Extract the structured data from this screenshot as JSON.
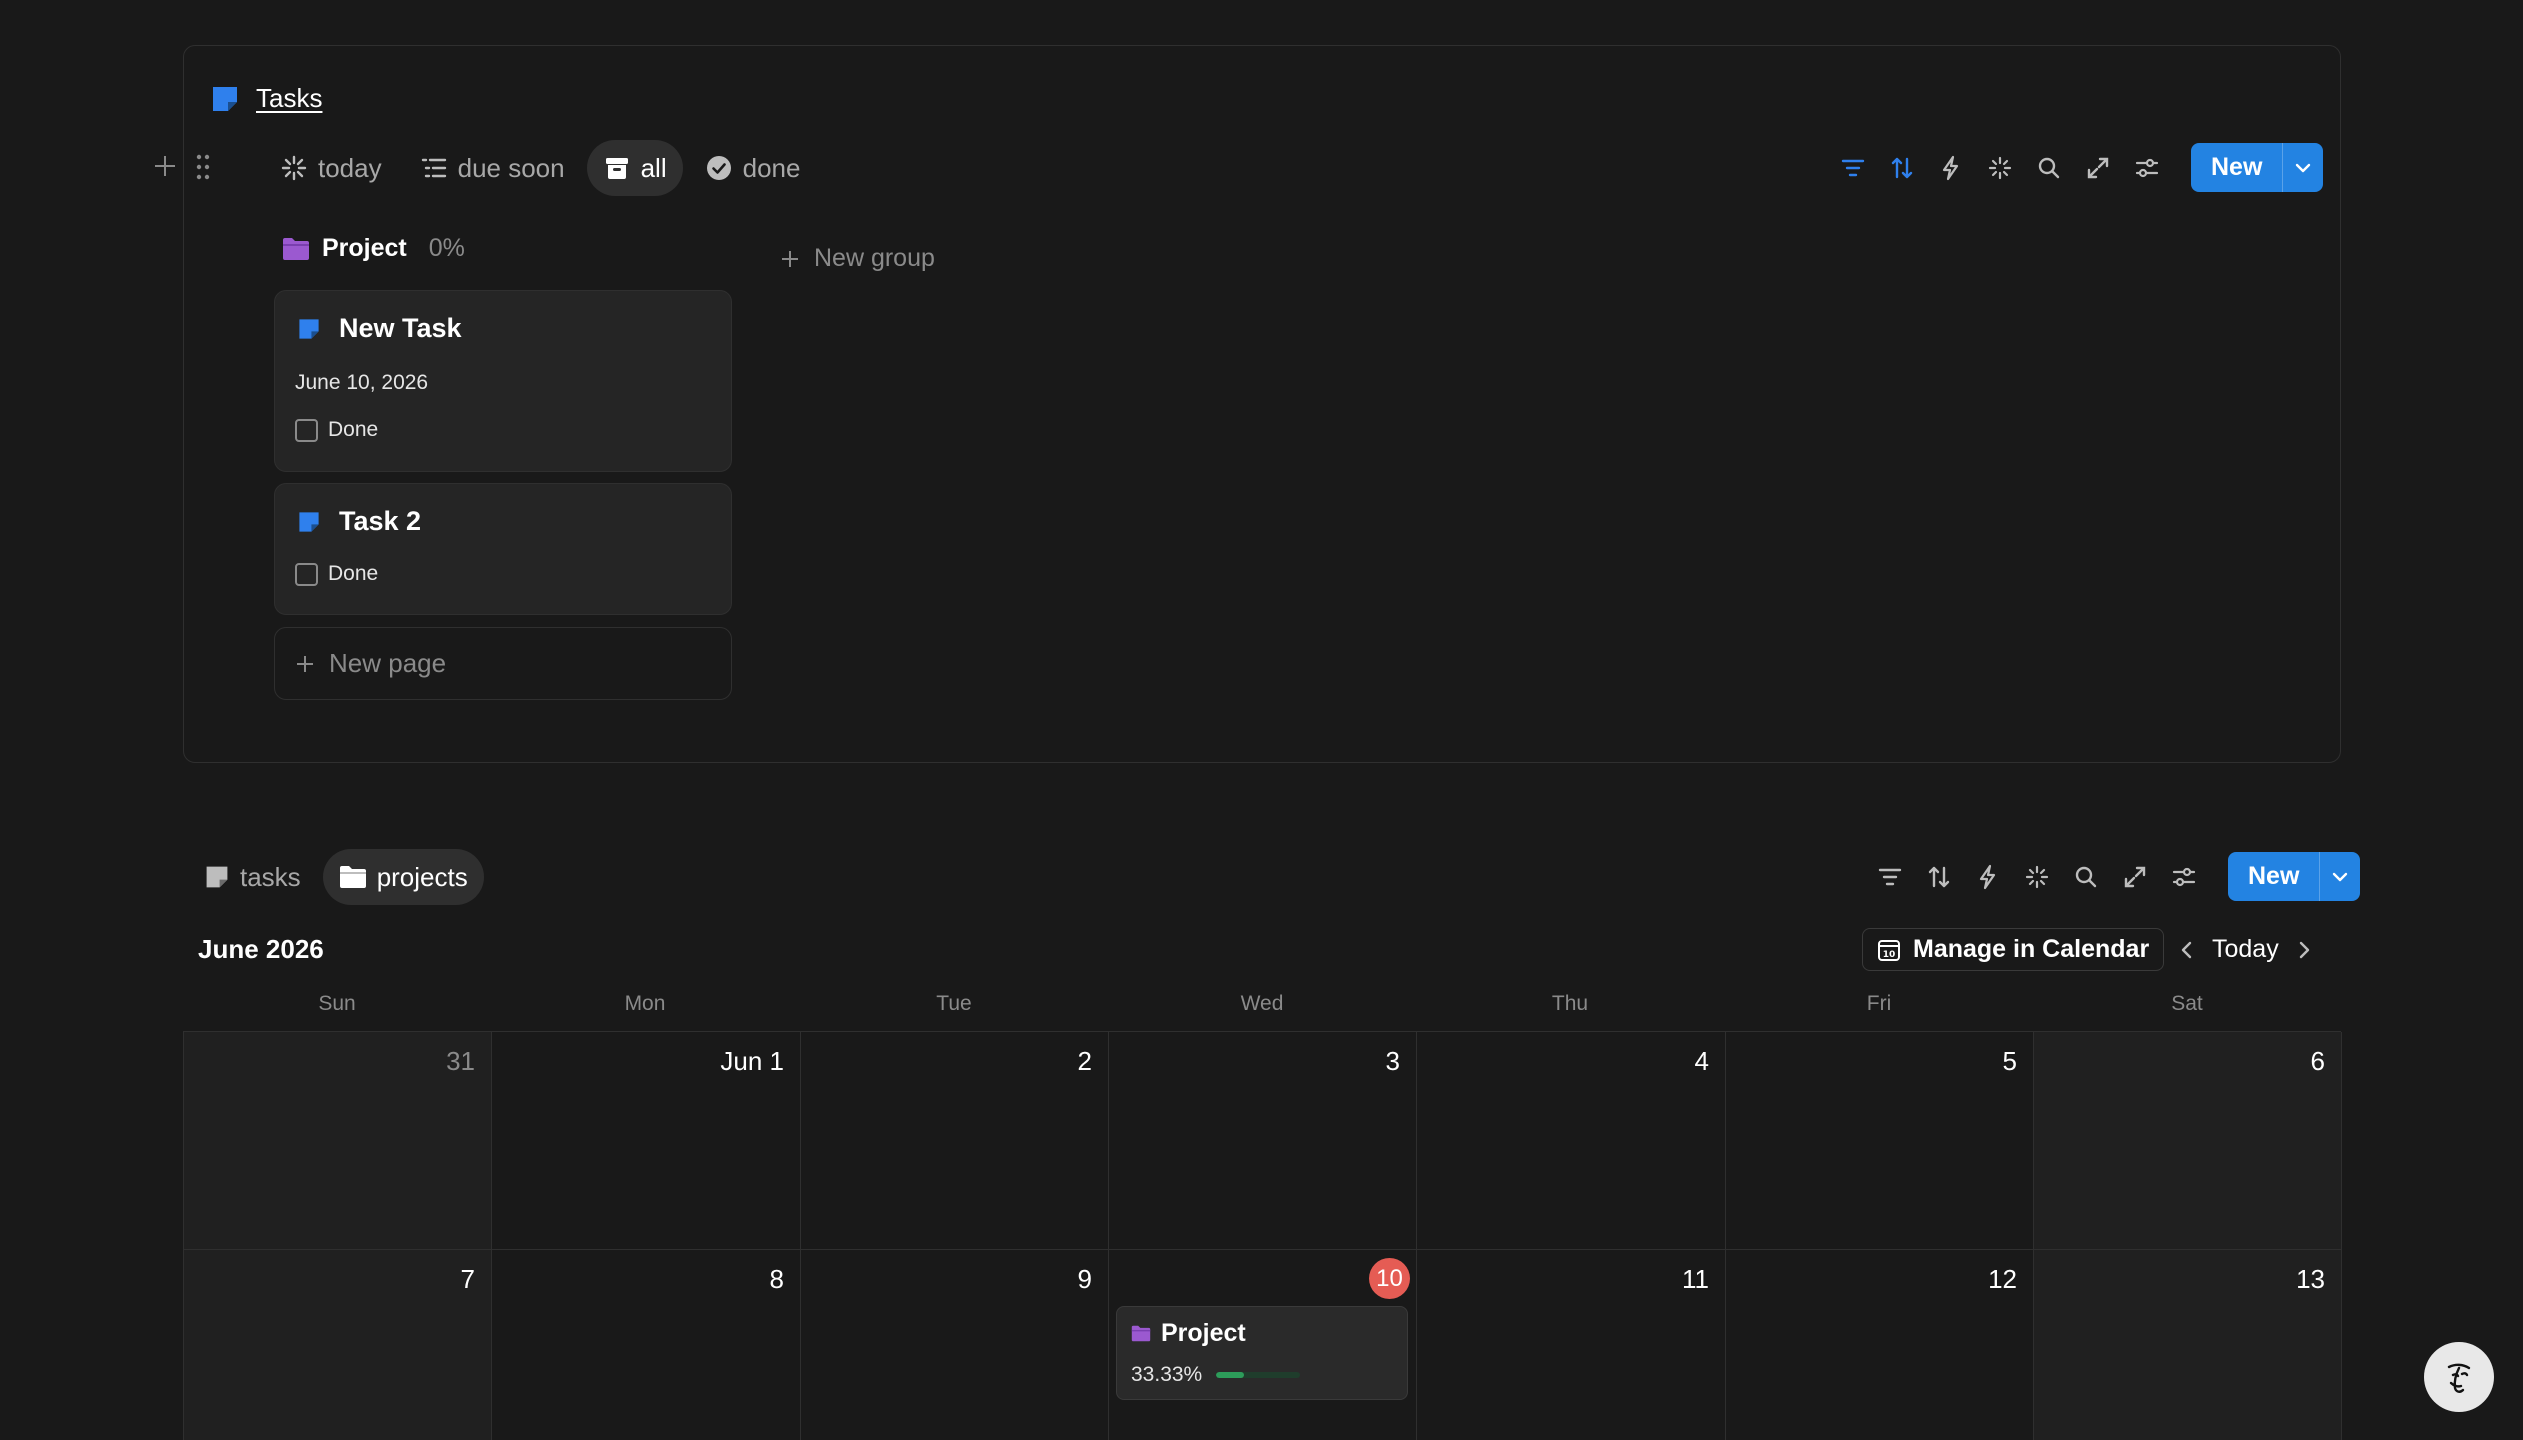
{
  "tasks_db": {
    "title": "Tasks",
    "tabs": [
      {
        "label": "today",
        "icon": "sparkle-loading-icon"
      },
      {
        "label": "due soon",
        "icon": "list-icon"
      },
      {
        "label": "all",
        "icon": "archive-icon",
        "active": true
      },
      {
        "label": "done",
        "icon": "check-circle-icon"
      }
    ],
    "toolbar": {
      "icons": [
        "filter-icon",
        "sort-icon",
        "lightning-icon",
        "sparkle-icon",
        "search-icon",
        "expand-icon",
        "settings-sliders-icon"
      ],
      "new_label": "New"
    },
    "group": {
      "name": "Project",
      "percent": "0%"
    },
    "cards": [
      {
        "title": "New Task",
        "date": "June 10, 2026",
        "done_label": "Done"
      },
      {
        "title": "Task 2",
        "done_label": "Done"
      }
    ],
    "new_page_label": "New page",
    "new_group_label": "New group"
  },
  "calendar_view": {
    "tabs": [
      {
        "label": "tasks",
        "icon": "page-icon"
      },
      {
        "label": "projects",
        "icon": "folder-icon",
        "active": true
      }
    ],
    "new_label": "New",
    "month_label": "June 2026",
    "manage_label": "Manage in Calendar",
    "today_label": "Today",
    "weekdays": [
      "Sun",
      "Mon",
      "Tue",
      "Wed",
      "Thu",
      "Fri",
      "Sat"
    ],
    "weeks": [
      [
        "31",
        "Jun 1",
        "2",
        "3",
        "4",
        "5",
        "6"
      ],
      [
        "7",
        "8",
        "9",
        "10",
        "11",
        "12",
        "13"
      ]
    ],
    "today_day": "10",
    "event": {
      "title": "Project",
      "progress_text": "33.33%",
      "progress": 0.3333
    }
  },
  "colors": {
    "accent": "#2383e2",
    "background": "#191919",
    "today": "#e55c54",
    "progress": "#2d9c5a",
    "folder": "#9b59d0"
  }
}
